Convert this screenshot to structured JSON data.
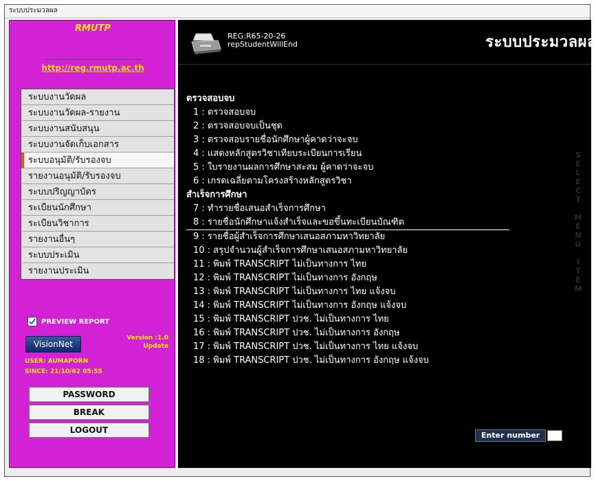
{
  "window": {
    "title": "ระบบประมวลผล"
  },
  "left_panel": {
    "brand": "RMUTP",
    "url": "http://reg.rmutp.ac.th",
    "menu": [
      {
        "label": "ระบบงานวัดผล"
      },
      {
        "label": "ระบบงานวัดผล-รายงาน"
      },
      {
        "label": "ระบบงานสนับสนุน"
      },
      {
        "label": "ระบบงานจัดเก็บเอกสาร"
      },
      {
        "label": "ระบบอนุมัติ/รับรองจบ",
        "active": true
      },
      {
        "label": "รายงานอนุมัติ/รับรองจบ"
      },
      {
        "label": "ระบบปริญญาบัตร"
      },
      {
        "label": "ระเบียนนักศึกษา"
      },
      {
        "label": "ระเบียนวิชาการ"
      },
      {
        "label": "รายงานอื่นๆ"
      },
      {
        "label": "ระบบประเมิน"
      },
      {
        "label": "รายงานประเมิน"
      }
    ],
    "preview_label": "PREVIEW REPORT",
    "preview_checked": true,
    "visionnet_label": "VisionNet",
    "version_text": "Version :1.0",
    "update_text": "Update",
    "user_text": "USER: AUMAPORN",
    "since_text": "SINCE: 21/10/62 05:55",
    "buttons": {
      "password": "PASSWORD",
      "break": "BREAK",
      "logout": "LOGOUT"
    },
    "colors": {
      "panel": "#d321d6",
      "brand": "#ffe800",
      "active_marker": "#e8531a"
    }
  },
  "header": {
    "report_code": "REG:R65-20-26",
    "report_name": "repStudentWillEnd",
    "title": "ระบบประมวลผล"
  },
  "content": {
    "sections": [
      {
        "title": "ตรวจสอบจบ",
        "items": [
          {
            "text": "1 : ตรวจสอบจบ"
          },
          {
            "text": "2 : ตรวจสอบจบเป็นชุด"
          },
          {
            "text": "3 : ตรวจสอบรายชื่อนักศึกษาผู้คาดว่าจะจบ"
          },
          {
            "text": "4 : แสดงหลักสูตรวิชาเทียบระเบียนการเรียน"
          },
          {
            "text": "5 : ใบรายงานผลการศึกษาสะสม ผู้คาดว่าจะจบ"
          },
          {
            "text": "6 : เกรดเฉลี่ยตามโครงสร้างหลักสูตรวิชา"
          }
        ]
      },
      {
        "title": "สำเร็จการศึกษา",
        "items": [
          {
            "text": "7 : ทำรายชื่อเสนอสำเร็จการศึกษา"
          },
          {
            "text": "8 : รายชื่อนักศึกษาแจ้งสำเร็จและขอขึ้นทะเบียนบัณฑิต",
            "highlight": true
          },
          {
            "text": "9 : รายชื่อผู้สำเร็จการศึกษาเสนอสภามหาวิทยาลัย"
          },
          {
            "text": "10 : สรุปจำนวนผู้สำเร็จการศึกษาเสนอสภามหาวิทยาลัย"
          },
          {
            "text": "11 : พิมพ์ TRANSCRIPT ไม่เป็นทางการ ไทย"
          },
          {
            "text": "12 : พิมพ์ TRANSCRIPT ไม่เป็นทางการ อังกฤษ"
          },
          {
            "text": "13 : พิมพ์ TRANSCRIPT ไม่เป็นทางการ ไทย แจ้งจบ"
          },
          {
            "text": "14 : พิมพ์ TRANSCRIPT ไม่เป็นทางการ อังกฤษ แจ้งจบ"
          },
          {
            "text": "15 : พิมพ์ TRANSCRIPT ปวช. ไม่เป็นทางการ ไทย"
          },
          {
            "text": "16 : พิมพ์ TRANSCRIPT ปวช. ไม่เป็นทางการ อังกฤษ"
          },
          {
            "text": "17 : พิมพ์ TRANSCRIPT ปวช. ไม่เป็นทางการ ไทย แจ้งจบ"
          },
          {
            "text": "18 : พิมพ์ TRANSCRIPT ปวช. ไม่เป็นทางการ อังกฤษ แจ้งจบ"
          }
        ]
      }
    ],
    "enter_label": "Enter number",
    "enter_value": ""
  },
  "side_text": [
    "S",
    "E",
    "L",
    "E",
    "C",
    "T",
    " ",
    "M",
    "E",
    "N",
    "U",
    " ",
    "I",
    "T",
    "E",
    "M"
  ],
  "icons": {
    "printer": "printer-icon",
    "checkbox": "checkmark-icon"
  }
}
